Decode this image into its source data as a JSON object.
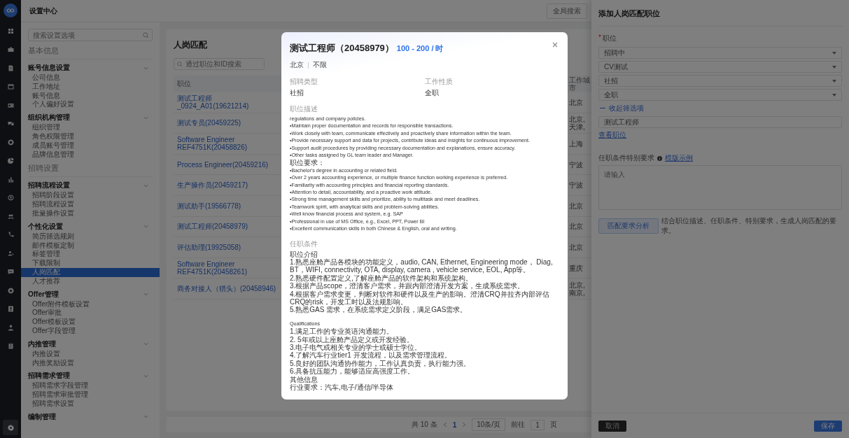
{
  "rail": [
    {
      "selected": false
    },
    {
      "selected": false
    },
    {
      "selected": false
    },
    {
      "selected": false
    },
    {
      "selected": false
    },
    {
      "selected": false
    },
    {
      "selected": false
    },
    {
      "selected": false
    },
    {
      "selected": false
    },
    {
      "selected": false
    },
    {
      "selected": false
    },
    {
      "selected": false
    },
    {
      "selected": false
    },
    {
      "selected": false
    },
    {
      "selected": false
    },
    {
      "selected": false
    },
    {
      "selected": false
    },
    {
      "selected": false
    },
    {
      "selected": true
    }
  ],
  "header": {
    "title": "设置中心",
    "search_button": "全局搜索"
  },
  "sidebar": {
    "search": {
      "placeholder": "搜索设置选项"
    },
    "sections": [
      {
        "title": "基本信息",
        "groups": [
          {
            "title": "账号信息设置",
            "items": [
              {
                "label": "公司信息",
                "selected": false
              },
              {
                "label": "工作地址",
                "selected": false
              },
              {
                "label": "账号信息",
                "selected": false
              },
              {
                "label": "个人偏好设置",
                "selected": false
              }
            ]
          },
          {
            "title": "组织机构管理",
            "items": [
              {
                "label": "组织管理",
                "selected": false
              },
              {
                "label": "角色权限管理",
                "selected": false
              },
              {
                "label": "成员账号管理",
                "selected": false
              },
              {
                "label": "品牌信息管理",
                "selected": false
              }
            ]
          }
        ]
      },
      {
        "title": "招聘设置",
        "groups": [
          {
            "title": "招聘流程设置",
            "items": [
              {
                "label": "招聘阶段设置",
                "selected": false
              },
              {
                "label": "招聘流程设置",
                "selected": false
              },
              {
                "label": "批量操作设置",
                "selected": false
              }
            ]
          },
          {
            "title": "个性化设置",
            "items": [
              {
                "label": "简历筛选规则",
                "selected": false
              },
              {
                "label": "邮件模板定制",
                "selected": false
              },
              {
                "label": "标签管理",
                "selected": false
              },
              {
                "label": "下载限制",
                "selected": false
              },
              {
                "label": "人岗匹配",
                "selected": true
              },
              {
                "label": "人才推荐",
                "selected": false
              }
            ]
          },
          {
            "title": "Offer管理",
            "items": [
              {
                "label": "Offer附件模板设置",
                "selected": false
              },
              {
                "label": "Offer审批",
                "selected": false
              },
              {
                "label": "Offer模板设置",
                "selected": false
              },
              {
                "label": "Offer字段管理",
                "selected": false
              }
            ]
          },
          {
            "title": "内推管理",
            "items": [
              {
                "label": "内推设置",
                "selected": false
              },
              {
                "label": "内推奖励设置",
                "selected": false
              }
            ]
          },
          {
            "title": "招聘需求管理",
            "items": [
              {
                "label": "招聘需求字段管理",
                "selected": false
              },
              {
                "label": "招聘需求审批管理",
                "selected": false
              },
              {
                "label": "招聘需求设置",
                "selected": false
              }
            ]
          },
          {
            "title": "编制管理"
          }
        ]
      }
    ]
  },
  "main": {
    "title": "人岗匹配",
    "search": {
      "placeholder": "通过职位和ID搜索"
    },
    "table": {
      "columns": [
        "职位",
        "工作城市"
      ],
      "rows": [
        {
          "position": "测试工程师_0924_A01(19621214)",
          "city": "北京"
        },
        {
          "position": "测试专员(20459225)",
          "city": "北京,天津,"
        },
        {
          "position": "Software Engineer REF4751K(20458826)",
          "city": "上海"
        },
        {
          "position": "Process Engineer(20459216)",
          "city": "宁波"
        },
        {
          "position": "生产操作员(20459217)",
          "city": "宁波"
        },
        {
          "position": "测试助手(19566778)",
          "city": "北京"
        },
        {
          "position": "测试工程师(20458979)",
          "city": "北京"
        },
        {
          "position": "评估助理(19925058)",
          "city": "北京"
        },
        {
          "position": "Software Engineer REF4751K(20458261)",
          "city": "重庆"
        },
        {
          "position": "商务对接人（猎头）(20458946)",
          "city": "北京,南京,"
        }
      ]
    },
    "pagination": {
      "total": "共 10 条",
      "pages": [
        {
          "label": "1",
          "selected": true
        }
      ],
      "page_size": "10条/页",
      "goto_label": "前往",
      "goto_value": "1",
      "goto_suffix": "页"
    }
  },
  "modal": {
    "title": "测试工程师（20458979）",
    "salary": "100 - 200 / 时",
    "location": "北京",
    "experience": "不限",
    "fields": [
      {
        "label": "招聘类型",
        "value": "社招"
      },
      {
        "label": "工作性质",
        "value": "全职"
      }
    ],
    "sections": [
      {
        "label": "职位描述",
        "blocks": [
          {
            "lines": [
              {
                "kind": "latin",
                "text": "regulations and company policies."
              },
              {
                "kind": "latin",
                "text": "•Maintain proper documentation and records for responsible transactions."
              },
              {
                "kind": "latin",
                "text": "•Work closely with team, communicate effectively and proactively share information within the team."
              },
              {
                "kind": "latin",
                "text": "•Provide necessary support and data for projects, contribute ideas and insights for continuous improvement."
              },
              {
                "kind": "latin",
                "text": "•Support audit procedures by providing necessary documentation and explanations, ensure accuracy."
              },
              {
                "kind": "latin",
                "text": "•Other tasks assigned by GL team leader and Manager."
              },
              {
                "kind": "cjk",
                "text": "职位要求："
              },
              {
                "kind": "latin",
                "text": "•Bachelor's degree in accounting or related field."
              },
              {
                "kind": "latin",
                "text": "•Over 2 years accounting experience, or multiple finance function working experience is preferred."
              },
              {
                "kind": "latin",
                "text": "•Familiarity with accounting principles and financial reporting standards."
              },
              {
                "kind": "latin",
                "text": "•Attention to detail, accountability, and a proactive work attitude."
              },
              {
                "kind": "latin",
                "text": "•Strong time management skills and prioritize, ability to multitask and meet deadlines."
              },
              {
                "kind": "latin",
                "text": "•Teamwork spirit, with analytical skills and problem-solving abilities."
              },
              {
                "kind": "latin",
                "text": "•Well know financial process and system, e.g. SAP"
              },
              {
                "kind": "latin",
                "text": "•Professional in use of MS Office, e.g., Excel, PPT, Power BI"
              },
              {
                "kind": "latin",
                "text": "•Excellent communication skills in both Chinese & English, oral and writing."
              }
            ]
          }
        ]
      },
      {
        "label": "任职条件",
        "blocks": [
          {
            "lines": [
              {
                "kind": "cjk",
                "text": "职位介绍"
              },
              {
                "kind": "cjk",
                "text": "1.熟悉座舱产品各模块的功能定义，audio, CAN, Ethernet, Engineering mode， Diag, BT，WIFI, connectivity, OTA, display, camera , vehicle service, EOL, App等。"
              },
              {
                "kind": "cjk",
                "text": "2.熟悉硬件配置定义,了解座舱产品的软件架构和系统架构。"
              },
              {
                "kind": "cjk",
                "text": "3.根据产品scope，澄清客户需求，并跟内部澄清开发方案，生成系统需求。"
              },
              {
                "kind": "cjk",
                "text": "4.根据客户需求变更，判断对软件和硬件以及生产的影响。澄清CRQ并拉齐内部评估CRQ的risk，开发工时以及法规影响。"
              },
              {
                "kind": "cjk",
                "text": "5.熟悉GAS 需求，在系统需求定义阶段，满足GAS需求。"
              }
            ]
          },
          {
            "lines": [
              {
                "kind": "latin",
                "text": "Qualifications"
              },
              {
                "kind": "cjk",
                "text": "1.满足工作的专业英语沟通能力。"
              },
              {
                "kind": "cjk",
                "text": "2. 5年或以上座舱产品定义或开发经验。"
              },
              {
                "kind": "cjk",
                "text": "3.电子电气或相关专业的学士或硕士学位。"
              },
              {
                "kind": "cjk",
                "text": "4.了解汽车行业tier1 开发流程，以及需求管理流程。"
              },
              {
                "kind": "cjk",
                "text": "5.良好的团队沟通协作能力，工作认真负责，执行能力强。"
              },
              {
                "kind": "cjk",
                "text": "6.具备抗压能力，能够适应高强度工作。"
              },
              {
                "kind": "cjk",
                "text": "其他信息"
              },
              {
                "kind": "cjk",
                "text": "行业要求：汽车,电子/通信/半导体"
              }
            ]
          }
        ]
      }
    ]
  },
  "drawer": {
    "title": "添加人岗匹配职位",
    "required_mark": "*",
    "position_label": "职位",
    "selects": [
      "招聘中",
      "CV测试",
      "社招",
      "全职"
    ],
    "collapse_link": "收起筛选项",
    "keyword": "测试工程师",
    "view_link": "查看职位",
    "requirement_label": "任职条件特别要求",
    "template_link": "模版示例",
    "textarea_placeholder": "请输入",
    "analyze_button": "匹配要求分析",
    "analyze_hint": "结合职位描述、任职条件、特别要求，生成人岗匹配的要求。",
    "cancel": "取消",
    "save": "保存"
  }
}
